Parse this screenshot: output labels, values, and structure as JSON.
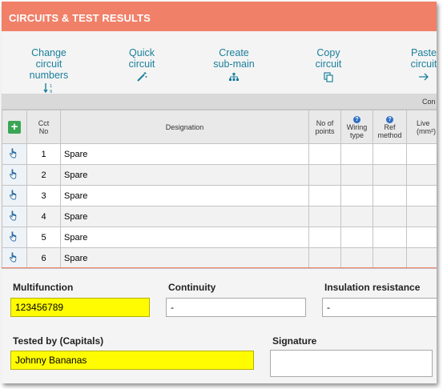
{
  "window": {
    "title": "CIRCUITS & TEST RESULTS"
  },
  "toolbar": {
    "change": {
      "line1": "Change circuit",
      "line2": "numbers",
      "icon": "sort-numeric-icon"
    },
    "quick": {
      "line1": "Quick",
      "line2": "circuit",
      "icon": "magic-wand-icon"
    },
    "submain": {
      "line1": "Create",
      "line2": "sub-main",
      "icon": "sitemap-icon"
    },
    "copy": {
      "line1": "Copy",
      "line2": "circuit",
      "icon": "copy-icon"
    },
    "paste": {
      "line1": "Paste",
      "line2": "circuit",
      "icon": "arrow-right-icon"
    }
  },
  "grid": {
    "group_label": "Con",
    "headers": {
      "cct_no_1": "Cct",
      "cct_no_2": "No",
      "designation": "Designation",
      "points_1": "No of",
      "points_2": "points",
      "wiring_1": "Wiring",
      "wiring_2": "type",
      "ref_1": "Ref",
      "ref_2": "method",
      "live_1": "Live",
      "live_2": "(mm²)"
    },
    "rows": [
      {
        "num": "1",
        "designation": "Spare"
      },
      {
        "num": "2",
        "designation": "Spare"
      },
      {
        "num": "3",
        "designation": "Spare"
      },
      {
        "num": "4",
        "designation": "Spare"
      },
      {
        "num": "5",
        "designation": "Spare"
      },
      {
        "num": "6",
        "designation": "Spare"
      }
    ]
  },
  "form": {
    "multifunction": {
      "label": "Multifunction",
      "value": "123456789"
    },
    "continuity": {
      "label": "Continuity",
      "value": "-"
    },
    "insulation": {
      "label": "Insulation resistance",
      "value": "-"
    },
    "tested_by": {
      "label": "Tested by (Capitals)",
      "value": "Johnny Bananas"
    },
    "signature": {
      "label": "Signature"
    }
  },
  "colors": {
    "header": "#f08068",
    "link": "#1a7f9b",
    "highlight": "#fffb00",
    "add": "#3aa655"
  }
}
